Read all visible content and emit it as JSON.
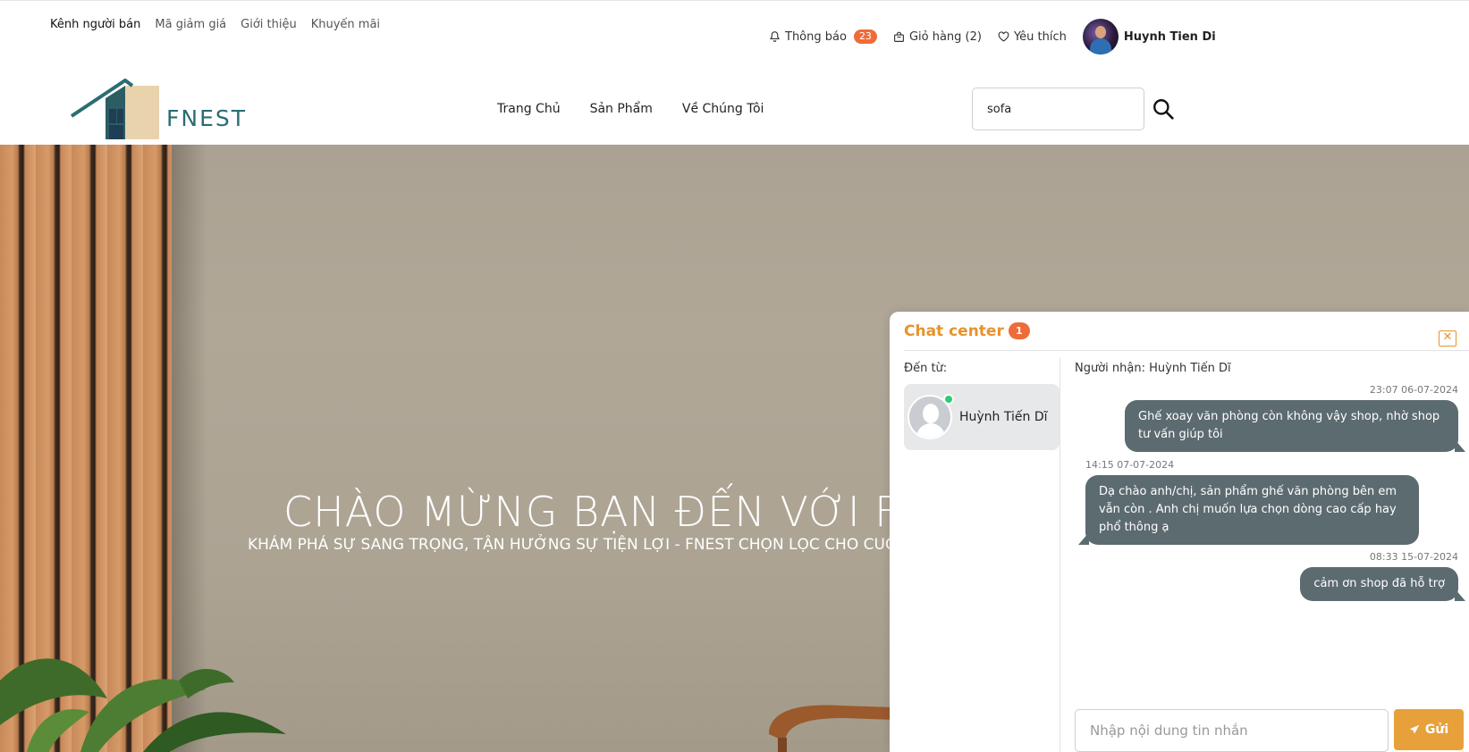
{
  "top_links": [
    {
      "label": "Kênh người bán",
      "active": true
    },
    {
      "label": "Mã giảm giá",
      "active": false
    },
    {
      "label": "Giới thiệu",
      "active": false
    },
    {
      "label": "Khuyến mãi",
      "active": false
    }
  ],
  "top_right": {
    "notifications_label": "Thông báo",
    "notifications_count": "23",
    "cart_label": "Giỏ hàng (2)",
    "wishlist_label": "Yêu thích",
    "user_name": "Huynh Tien Di"
  },
  "logo": {
    "text": "FNEST"
  },
  "nav": [
    {
      "label": "Trang Chủ"
    },
    {
      "label": "Sản Phẩm"
    },
    {
      "label": "Về Chúng Tôi"
    }
  ],
  "search": {
    "value": "sofa"
  },
  "hero": {
    "title": "CHÀO MỪNG BẠN ĐẾN VỚI FNEST",
    "subtitle": "KHÁM PHÁ SỰ SANG TRỌNG, TẬN HƯỞNG SỰ TIỆN LỢI - FNEST CHỌN LỌC CHO CUỘC SỐNG"
  },
  "chat": {
    "title": "Chat center",
    "unread": "1",
    "from_label": "Đến từ:",
    "contact_name": "Huỳnh Tiến Dĩ",
    "recipient_label": "Người nhận: Huỳnh Tiến Dĩ",
    "messages": [
      {
        "direction": "out",
        "time": "23:07 06-07-2024",
        "text": "Ghế xoay văn phòng còn không vậy shop, nhờ shop tư vấn giúp tôi"
      },
      {
        "direction": "in",
        "time": "14:15 07-07-2024",
        "text": "Dạ chào anh/chị, sản phẩm ghế văn phòng bên em vẫn còn . Anh chị muốn lựa chọn dòng cao cấp hay phổ thông ạ"
      },
      {
        "direction": "out",
        "time": "08:33 15-07-2024",
        "text": "cảm ơn shop đã hỗ trợ"
      }
    ],
    "input_placeholder": "Nhập nội dung tin nhắn",
    "send_label": "Gửi"
  },
  "colors": {
    "accent": "#e8932b",
    "badge": "#ee6c3a",
    "bubble": "#5c6b70",
    "brand": "#2b6d72"
  }
}
